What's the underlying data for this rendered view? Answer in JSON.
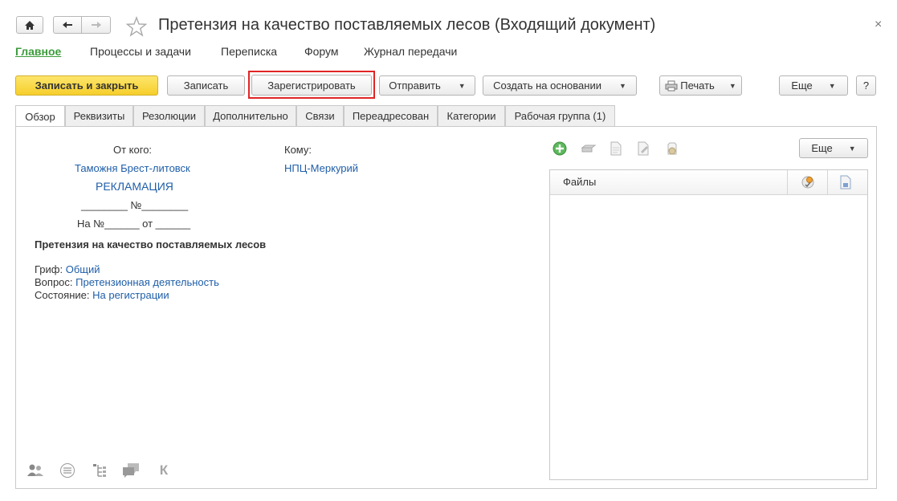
{
  "window": {
    "title": "Претензия на качество поставляемых лесов (Входящий документ)",
    "close_glyph": "×"
  },
  "nav": {
    "home_icon": "home-icon",
    "back_icon": "arrow-left-icon",
    "forward_icon": "arrow-right-icon",
    "favorite_icon": "star-icon"
  },
  "sections": [
    {
      "label": "Главное",
      "active": true
    },
    {
      "label": "Процессы и задачи"
    },
    {
      "label": "Переписка"
    },
    {
      "label": "Форум"
    },
    {
      "label": "Журнал передачи"
    }
  ],
  "toolbar": {
    "save_close": "Записать и закрыть",
    "save": "Записать",
    "register": "Зарегистрировать",
    "send": "Отправить",
    "create_based": "Создать на основании",
    "print": "Печать",
    "more": "Еще",
    "help": "?"
  },
  "tabs": [
    {
      "label": "Обзор",
      "active": true
    },
    {
      "label": "Реквизиты"
    },
    {
      "label": "Резолюции"
    },
    {
      "label": "Дополнительно"
    },
    {
      "label": "Связи"
    },
    {
      "label": "Переадресован"
    },
    {
      "label": "Категории"
    },
    {
      "label": "Рабочая группа (1)"
    }
  ],
  "overview": {
    "from_label": "От кого:",
    "from_value": "Таможня Брест-литовск",
    "to_label": "Кому:",
    "to_value": "НПЦ-Меркурий",
    "doc_type": "РЕКЛАМАЦИЯ",
    "number_line": "________ №________",
    "reply_line": "На №______ от ______",
    "subject": "Претензия на качество поставляемых лесов",
    "grif_label": "Гриф:",
    "grif_value": "Общий",
    "question_label": "Вопрос:",
    "question_value": "Претензионная деятельность",
    "state_label": "Состояние:",
    "state_value": "На регистрации"
  },
  "files": {
    "more": "Еще",
    "column": "Файлы",
    "toolbar_icons": [
      "add-file-icon",
      "scan-icon",
      "open-file-icon",
      "edit-file-icon",
      "sign-file-icon"
    ]
  },
  "bottom_icons": [
    "users-icon",
    "discussion-icon",
    "structure-icon",
    "comments-icon",
    "k-letter-icon"
  ],
  "bottom_letter": "К",
  "colors": {
    "accent_green": "#3c9c3c",
    "primary_button": "#f6cf2b",
    "link_blue": "#1f5ea8",
    "highlight_red": "#e02525"
  }
}
